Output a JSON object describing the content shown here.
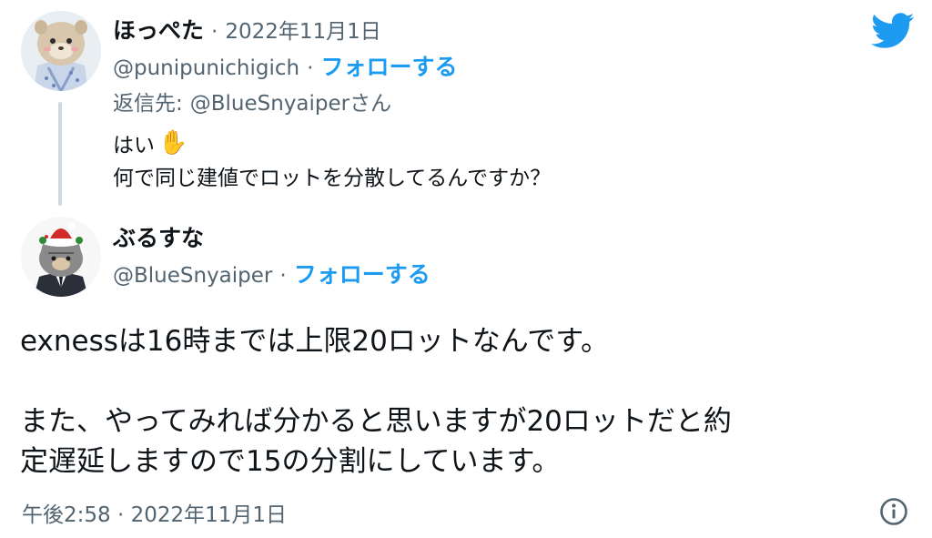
{
  "reply_tweet": {
    "display_name": "ほっぺた",
    "separator": "·",
    "date": "2022年11月1日",
    "handle": "@punipunichigich",
    "follow_separator": "·",
    "follow_label": "フォローする",
    "reply_to_prefix": "返信先:",
    "reply_to_handle": "@BlueSnyaiper",
    "reply_to_suffix": "さん",
    "line1_text": "はい",
    "line1_emoji": "✋",
    "line2": "何で同じ建値でロットを分散してるんですか？"
  },
  "main_tweet": {
    "display_name": "ぶるすな",
    "handle": "@BlueSnyaiper",
    "follow_separator": "·",
    "follow_label": "フォローする",
    "paragraph1": "exnessは16時までは上限20ロットなんです。",
    "paragraph2_line1": "また、やってみれば分かると思いますが20ロットだと約",
    "paragraph2_line2": "定遅延しますので15の分割にしています。",
    "timestamp": "午後2:58 · 2022年11月1日"
  },
  "colors": {
    "text": "#0f1419",
    "muted": "#536471",
    "accent": "#1d9bf0",
    "thread_line": "#cfd9de"
  },
  "icons": {
    "brand": "twitter-bird-icon",
    "info": "info-icon"
  }
}
